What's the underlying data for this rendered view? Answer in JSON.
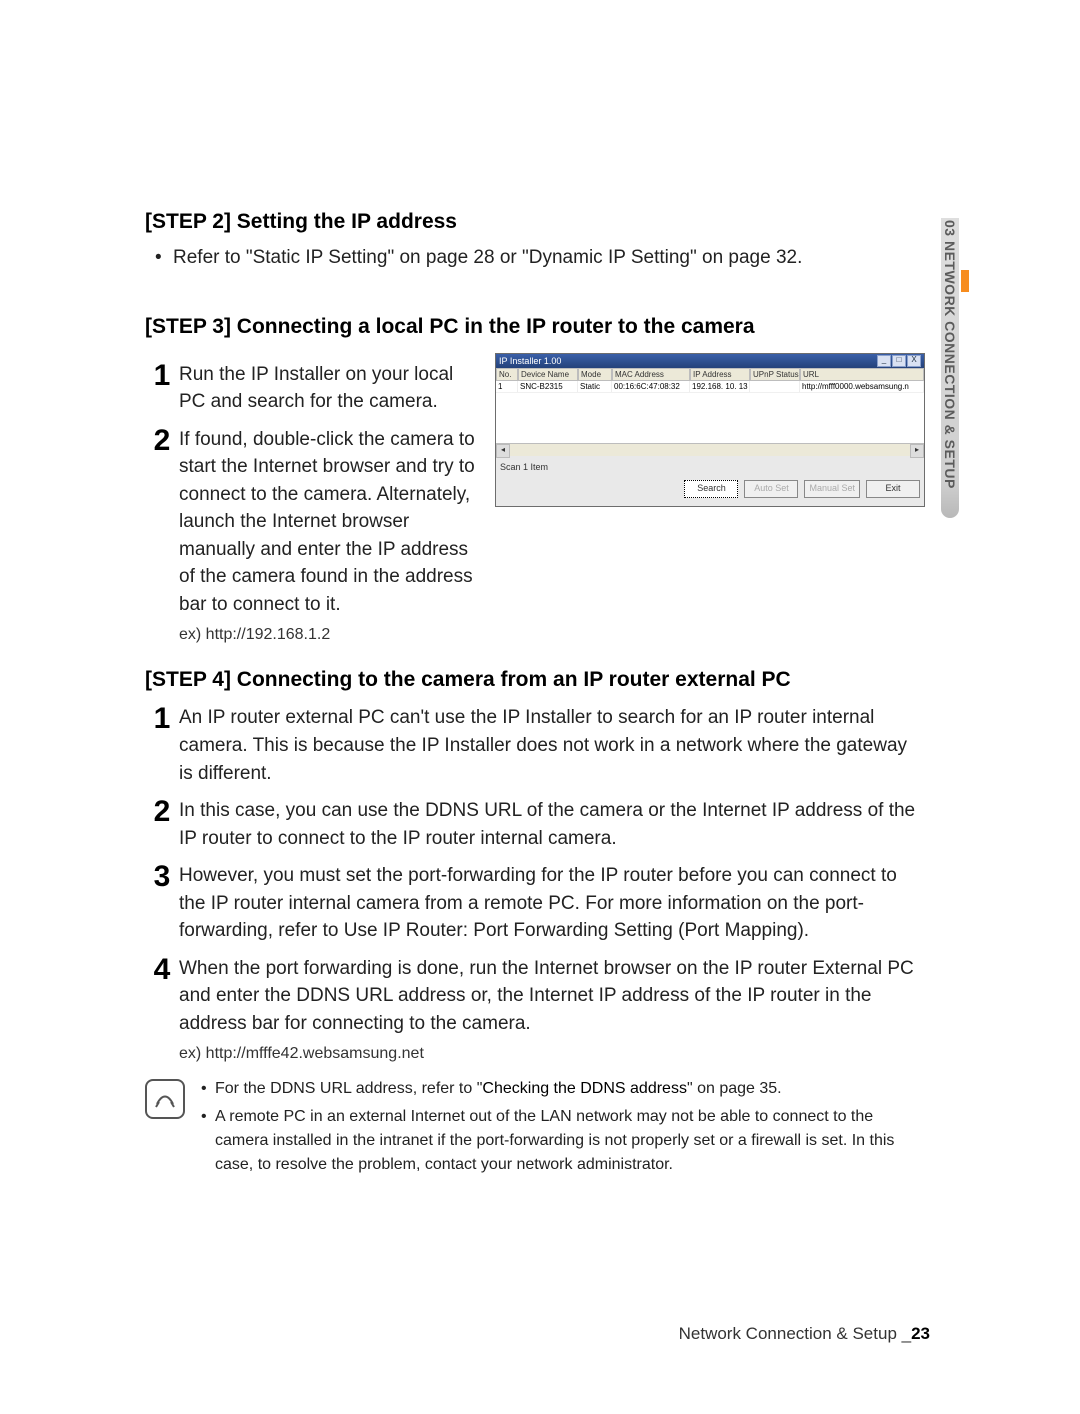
{
  "side_tab": "03 NETWORK CONNECTION & SETUP",
  "step2": {
    "title": "[STEP 2] Setting the IP address",
    "bullet": "Refer to \"Static IP Setting\" on page 28 or \"Dynamic IP Setting\" on page 32."
  },
  "step3": {
    "title": "[STEP 3] Connecting a local PC in the IP router to the camera",
    "items": [
      "Run the IP Installer on your local PC and search for the camera.",
      "If found, double-click the camera to start the Internet browser and try to connect to the camera. Alternately, launch the Internet browser manually and enter the IP address of the camera found in the address bar to connect to it."
    ],
    "example": "ex) http://192.168.1.2",
    "shot": {
      "title": "IP Installer 1.00",
      "headers": [
        "No.",
        "Device Name",
        "Mode",
        "MAC Address",
        "IP Address",
        "UPnP Status",
        "URL"
      ],
      "row": [
        "1",
        "SNC-B2315",
        "Static",
        "00:16:6C:47:08:32",
        "192.168. 10. 13",
        "",
        "http://mfff0000.websamsung.n"
      ],
      "scan": "Scan 1 Item",
      "buttons": {
        "search": "Search",
        "auto": "Auto Set",
        "manual": "Manual Set",
        "exit": "Exit"
      }
    }
  },
  "step4": {
    "title": "[STEP 4] Connecting to the camera from an IP router external PC",
    "items": [
      "An IP router external PC can't use the IP Installer to search for an IP router internal camera. This is because the IP Installer does not work in a network where the gateway is different.",
      "In this case, you can use the DDNS URL of the camera or the Internet IP address of the IP router to connect to the IP router internal camera.",
      "However, you must set the port-forwarding for the IP router before you can connect to the IP router internal camera from a remote PC. For more information on the port-forwarding, refer to Use IP Router: Port Forwarding Setting (Port Mapping).",
      "When the port forwarding is done, run the Internet browser on the IP router External PC and enter the DDNS URL address or, the Internet IP address of the IP router in the address bar for connecting to the camera."
    ],
    "example": "ex) http://mfffe42.websamsung.net",
    "note1_pre": "For the DDNS URL address, refer to \"",
    "note1_bold": "Checking the DDNS address",
    "note1_post": "\" on page 35.",
    "note2": "A remote PC in an external Internet out of the LAN network may not be able to connect to the camera installed in the intranet if the port-forwarding is not properly set or a firewall is set. In this case, to resolve the problem, contact your network administrator."
  },
  "footer": {
    "label": "Network Connection & Setup _",
    "page": "23"
  }
}
